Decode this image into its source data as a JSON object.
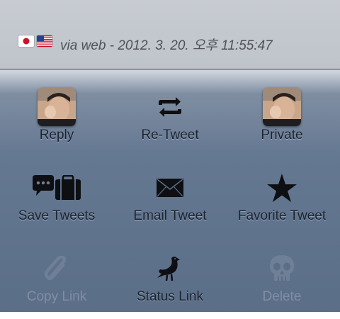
{
  "header": {
    "via_text": "via web - 2012. 3. 20. 오후 11:55:47",
    "flags": [
      "japan-flag-icon",
      "us-flag-icon"
    ]
  },
  "actions": [
    {
      "label": "Reply",
      "icon": "avatar",
      "enabled": true
    },
    {
      "label": "Re-Tweet",
      "icon": "retweet-icon",
      "enabled": true
    },
    {
      "label": "Private",
      "icon": "avatar",
      "enabled": true
    },
    {
      "label": "Save Tweets",
      "icon": "chat-briefcase-icon",
      "enabled": true
    },
    {
      "label": "Email Tweet",
      "icon": "envelope-icon",
      "enabled": true
    },
    {
      "label": "Favorite Tweet",
      "icon": "star-icon",
      "enabled": true
    },
    {
      "label": "Copy Link",
      "icon": "paperclip-icon",
      "enabled": false
    },
    {
      "label": "Status Link",
      "icon": "bird-icon",
      "enabled": true
    },
    {
      "label": "Delete",
      "icon": "skull-icon",
      "enabled": false
    }
  ],
  "colors": {
    "label": "#1b2230",
    "disabled_label": "#7f8ea2",
    "disabled_icon": "#6f7f95",
    "icon": "#0e0f12"
  }
}
